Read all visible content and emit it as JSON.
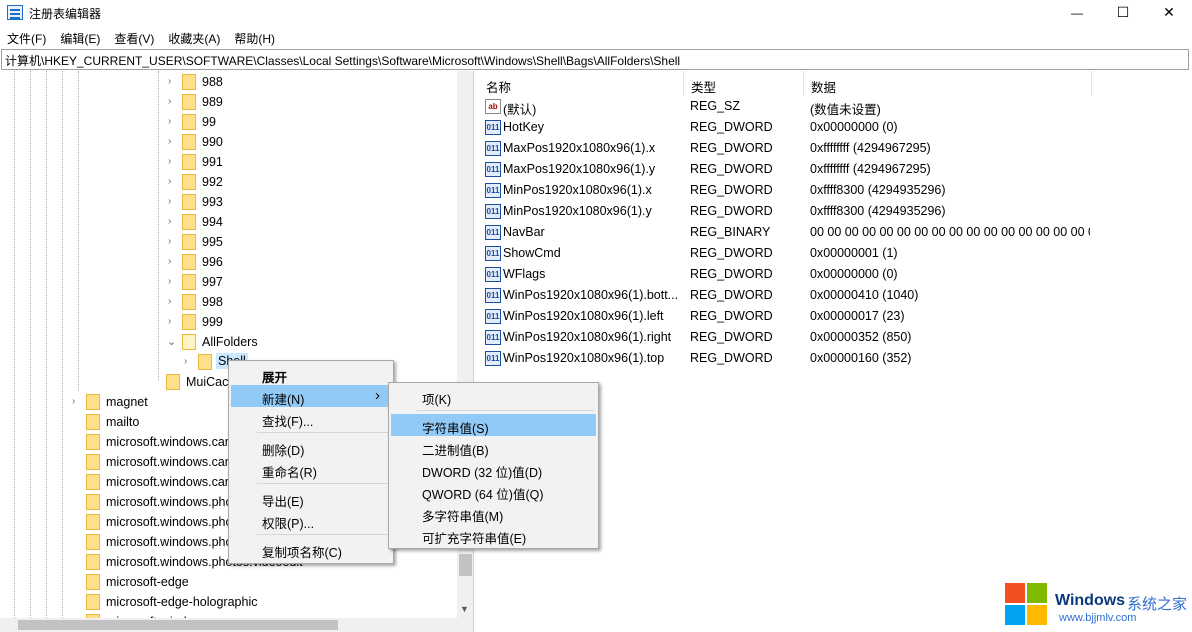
{
  "window": {
    "title": "注册表编辑器",
    "minimize": "—",
    "maximize": "☐",
    "close": "✕"
  },
  "menu": [
    "文件(F)",
    "编辑(E)",
    "查看(V)",
    "收藏夹(A)",
    "帮助(H)"
  ],
  "address": "计算机\\HKEY_CURRENT_USER\\SOFTWARE\\Classes\\Local Settings\\Software\\Microsoft\\Windows\\Shell\\Bags\\AllFolders\\Shell",
  "tree": {
    "numbered": [
      "988",
      "989",
      "99",
      "990",
      "991",
      "992",
      "993",
      "994",
      "995",
      "996",
      "997",
      "998",
      "999"
    ],
    "allfolders": "AllFolders",
    "shell": "Shell",
    "muicache": "MuiCache",
    "bottom": [
      "magnet",
      "mailto",
      "microsoft.windows.camera",
      "microsoft.windows.camera.multipicker",
      "microsoft.windows.camera.picker",
      "microsoft.windows.photos.crop",
      "microsoft.windows.photos.picker",
      "microsoft.windows.photos.settings",
      "microsoft.windows.photos.videoedit",
      "microsoft-edge",
      "microsoft-edge-holographic",
      "microsoft-windows"
    ]
  },
  "columns": {
    "name": "名称",
    "type": "类型",
    "data": "数据"
  },
  "values": [
    {
      "icon": "ab",
      "name": "(默认)",
      "type": "REG_SZ",
      "data": "(数值未设置)"
    },
    {
      "icon": "011",
      "name": "HotKey",
      "type": "REG_DWORD",
      "data": "0x00000000 (0)"
    },
    {
      "icon": "011",
      "name": "MaxPos1920x1080x96(1).x",
      "type": "REG_DWORD",
      "data": "0xffffffff (4294967295)"
    },
    {
      "icon": "011",
      "name": "MaxPos1920x1080x96(1).y",
      "type": "REG_DWORD",
      "data": "0xffffffff (4294967295)"
    },
    {
      "icon": "011",
      "name": "MinPos1920x1080x96(1).x",
      "type": "REG_DWORD",
      "data": "0xffff8300 (4294935296)"
    },
    {
      "icon": "011",
      "name": "MinPos1920x1080x96(1).y",
      "type": "REG_DWORD",
      "data": "0xffff8300 (4294935296)"
    },
    {
      "icon": "011",
      "name": "NavBar",
      "type": "REG_BINARY",
      "data": "00 00 00 00 00 00 00 00 00 00 00 00 00 00 00 00 00..."
    },
    {
      "icon": "011",
      "name": "ShowCmd",
      "type": "REG_DWORD",
      "data": "0x00000001 (1)"
    },
    {
      "icon": "011",
      "name": "WFlags",
      "type": "REG_DWORD",
      "data": "0x00000000 (0)"
    },
    {
      "icon": "011",
      "name": "WinPos1920x1080x96(1).bott...",
      "type": "REG_DWORD",
      "data": "0x00000410 (1040)"
    },
    {
      "icon": "011",
      "name": "WinPos1920x1080x96(1).left",
      "type": "REG_DWORD",
      "data": "0x00000017 (23)"
    },
    {
      "icon": "011",
      "name": "WinPos1920x1080x96(1).right",
      "type": "REG_DWORD",
      "data": "0x00000352 (850)"
    },
    {
      "icon": "011",
      "name": "WinPos1920x1080x96(1).top",
      "type": "REG_DWORD",
      "data": "0x00000160 (352)"
    }
  ],
  "context_menu": {
    "expand": "展开",
    "new": "新建(N)",
    "find": "查找(F)...",
    "delete": "删除(D)",
    "rename": "重命名(R)",
    "export": "导出(E)",
    "permissions": "权限(P)...",
    "copy_name": "复制项名称(C)",
    "submenu_arrow": "›"
  },
  "submenu": {
    "key": "项(K)",
    "string": "字符串值(S)",
    "binary": "二进制值(B)",
    "dword": "DWORD (32 位)值(D)",
    "qword": "QWORD (64 位)值(Q)",
    "multi": "多字符串值(M)",
    "expand": "可扩充字符串值(E)"
  },
  "watermark": {
    "brand": "Windows",
    "cn": "系统之家",
    "url": "www.bjjmlv.com"
  },
  "colors": {
    "menu_highlight": "#91c9f7",
    "selection": "#cce8ff",
    "folder": "#ffe08a"
  }
}
